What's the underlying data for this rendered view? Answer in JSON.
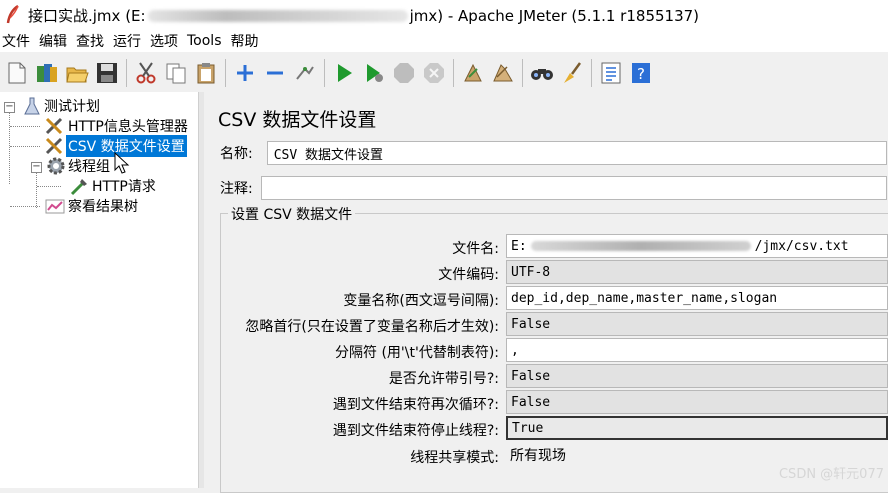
{
  "window": {
    "title_prefix": "接口实战.jmx (E:",
    "title_suffix": "jmx) - Apache JMeter (5.1.1 r1855137)"
  },
  "menu": [
    "文件",
    "编辑",
    "查找",
    "运行",
    "选项",
    "Tools",
    "帮助"
  ],
  "toolbar": {
    "buttons": [
      "new-icon",
      "templates-icon",
      "open-icon",
      "save-icon",
      "cut-icon",
      "copy-icon",
      "paste-icon",
      "expand-icon",
      "collapse-icon",
      "toggle-icon",
      "start-icon",
      "start-no-pause-icon",
      "stop-icon",
      "shutdown-icon",
      "clear-icon",
      "clear-all-icon",
      "search-icon",
      "reset-search-icon",
      "function-helper-icon",
      "help-icon"
    ]
  },
  "tree": {
    "test_plan": "测试计划",
    "header_manager": "HTTP信息头管理器",
    "csv_config": "CSV 数据文件设置",
    "thread_group": "线程组",
    "http_request": "HTTP请求",
    "results_tree": "察看结果树"
  },
  "panel": {
    "title": "CSV 数据文件设置",
    "name_label": "名称:",
    "name_value": "CSV 数据文件设置",
    "comment_label": "注释:",
    "comment_value": "",
    "group_title": "设置 CSV 数据文件"
  },
  "properties": [
    {
      "label": "文件名:",
      "value_prefix": "E:",
      "value_suffix": "/jmx/csv.txt"
    },
    {
      "label": "文件编码:",
      "value": "UTF-8"
    },
    {
      "label": "变量名称(西文逗号间隔):",
      "value": "dep_id,dep_name,master_name,slogan"
    },
    {
      "label": "忽略首行(只在设置了变量名称后才生效):",
      "value": "False"
    },
    {
      "label": "分隔符 (用'\\t'代替制表符):",
      "value": ","
    },
    {
      "label": "是否允许带引号?:",
      "value": "False"
    },
    {
      "label": "遇到文件结束符再次循环?:",
      "value": "False"
    },
    {
      "label": "遇到文件结束符停止线程?:",
      "value": "True"
    },
    {
      "label": "线程共享模式:",
      "value": "所有现场"
    }
  ],
  "watermark": "CSDN @轩元077",
  "colors": {
    "selection": "#0078d7",
    "start_green": "#1f9a2e"
  }
}
